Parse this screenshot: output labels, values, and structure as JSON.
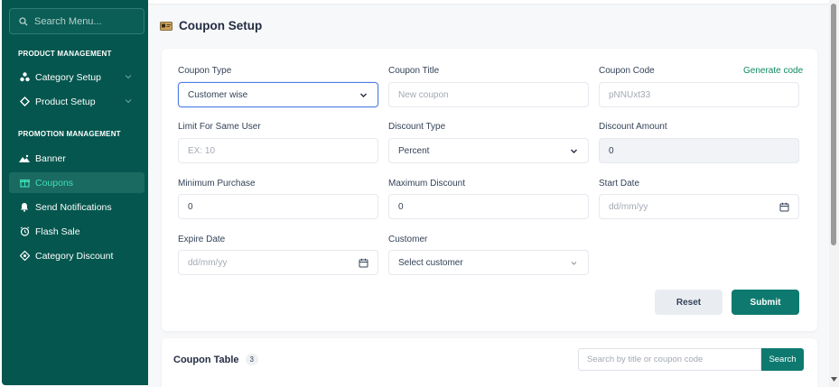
{
  "sidebar": {
    "search_placeholder": "Search Menu...",
    "sections": [
      {
        "heading": "PRODUCT MANAGEMENT"
      },
      {
        "heading": "PROMOTION MANAGEMENT"
      }
    ],
    "items": [
      {
        "label": "Category Setup",
        "icon": "category-icon"
      },
      {
        "label": "Product Setup",
        "icon": "product-icon"
      },
      {
        "label": "Banner",
        "icon": "banner-icon"
      },
      {
        "label": "Coupons",
        "icon": "gift-icon",
        "active": true
      },
      {
        "label": "Send Notifications",
        "icon": "bell-icon"
      },
      {
        "label": "Flash Sale",
        "icon": "alarm-icon"
      },
      {
        "label": "Category Discount",
        "icon": "discount-icon"
      }
    ]
  },
  "page": {
    "title": "Coupon Setup"
  },
  "form": {
    "coupon_type": {
      "label": "Coupon Type",
      "value": "Customer wise"
    },
    "coupon_title": {
      "label": "Coupon Title",
      "placeholder": "New coupon"
    },
    "coupon_code": {
      "label": "Coupon Code",
      "value": "pNNUxt33",
      "generate": "Generate code"
    },
    "limit_same_user": {
      "label": "Limit For Same User",
      "placeholder": "EX: 10"
    },
    "discount_type": {
      "label": "Discount Type",
      "value": "Percent"
    },
    "discount_amount": {
      "label": "Discount Amount",
      "value": "0"
    },
    "min_purchase": {
      "label": "Minimum Purchase",
      "value": "0"
    },
    "max_discount": {
      "label": "Maximum Discount",
      "value": "0"
    },
    "start_date": {
      "label": "Start Date",
      "placeholder": "dd/mm/yy"
    },
    "expire_date": {
      "label": "Expire Date",
      "placeholder": "dd/mm/yy"
    },
    "customer": {
      "label": "Customer",
      "value": "Select customer"
    },
    "reset_label": "Reset",
    "submit_label": "Submit"
  },
  "table": {
    "title": "Coupon Table",
    "count": "3",
    "search_placeholder": "Search by title or coupon code",
    "search_button": "Search"
  },
  "colors": {
    "sidebar_bg": "#04564e",
    "active_text": "#3ee0b5",
    "primary": "#0e7a6f",
    "link": "#0f8a5f"
  }
}
